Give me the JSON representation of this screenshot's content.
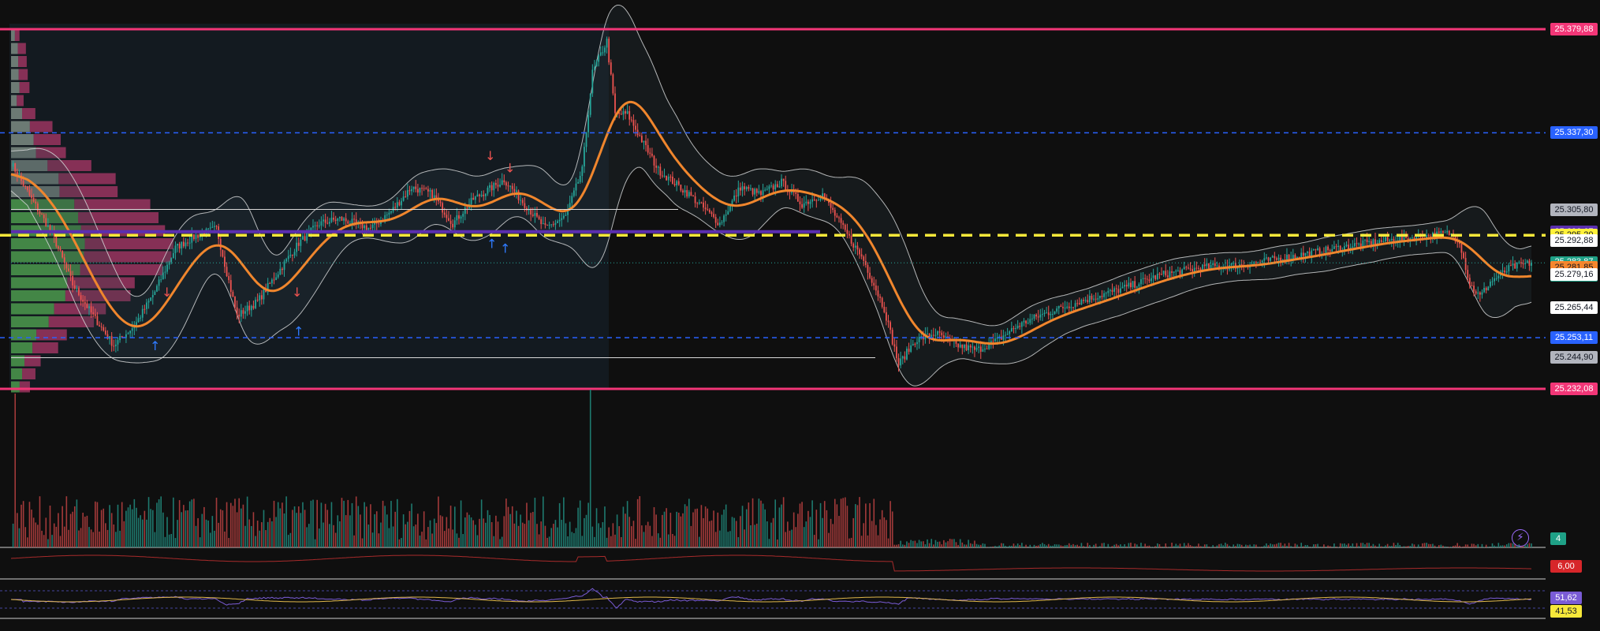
{
  "chart_data": {
    "type": "candlestick",
    "title": "",
    "price_axis": {
      "min": 25232.08,
      "max": 25379.88,
      "labels": [
        {
          "value": "25.379,88",
          "bg": "#f23677",
          "fg": "#ffffff"
        },
        {
          "value": "25.337,30",
          "bg": "#2962ff",
          "fg": "#ffffff"
        },
        {
          "value": "25.305,80",
          "bg": "#b2b5be",
          "fg": "#131722"
        },
        {
          "value": "25.296,67",
          "bg": "#5b2fb0",
          "fg": "#ffffff"
        },
        {
          "value": "25.295,20",
          "bg": "#fff23a",
          "fg": "#131722"
        },
        {
          "value": "25.292,88",
          "bg": "#ffffff",
          "fg": "#131722"
        },
        {
          "value": "25.283,87",
          "sub": "01:50",
          "bg": "#1fa187",
          "fg": "#ffffff"
        },
        {
          "value": "25.281,85",
          "bg": "#f5862d",
          "fg": "#131722"
        },
        {
          "value": "25.279,16",
          "bg": "#ffffff",
          "fg": "#131722"
        },
        {
          "value": "25.265,44",
          "bg": "#ffffff",
          "fg": "#131722"
        },
        {
          "value": "25.253,11",
          "bg": "#2962ff",
          "fg": "#ffffff"
        },
        {
          "value": "25.244,90",
          "bg": "#b2b5be",
          "fg": "#131722"
        },
        {
          "value": "25.232,08",
          "bg": "#f23677",
          "fg": "#ffffff"
        }
      ]
    },
    "horizontal_levels": [
      {
        "price": 25379.88,
        "style": "solid",
        "color": "#f23677"
      },
      {
        "price": 25337.3,
        "style": "dashed",
        "color": "#2962ff"
      },
      {
        "price": 25295.2,
        "style": "dashed",
        "color": "#f7e83a"
      },
      {
        "price": 25296.67,
        "style": "solid",
        "color": "#5b2fb0"
      },
      {
        "price": 25253.11,
        "style": "dashed",
        "color": "#2962ff"
      },
      {
        "price": 25232.08,
        "style": "solid",
        "color": "#f23677"
      }
    ],
    "close_path": [
      [
        0,
        25325
      ],
      [
        10,
        25310
      ],
      [
        20,
        25296
      ],
      [
        30,
        25275
      ],
      [
        40,
        25262
      ],
      [
        50,
        25250
      ],
      [
        60,
        25258
      ],
      [
        70,
        25272
      ],
      [
        80,
        25290
      ],
      [
        90,
        25295
      ],
      [
        100,
        25298
      ],
      [
        105,
        25280
      ],
      [
        110,
        25262
      ],
      [
        120,
        25268
      ],
      [
        130,
        25280
      ],
      [
        140,
        25292
      ],
      [
        150,
        25300
      ],
      [
        160,
        25302
      ],
      [
        175,
        25298
      ],
      [
        185,
        25305
      ],
      [
        195,
        25315
      ],
      [
        205,
        25312
      ],
      [
        215,
        25300
      ],
      [
        225,
        25310
      ],
      [
        240,
        25318
      ],
      [
        250,
        25308
      ],
      [
        260,
        25298
      ],
      [
        270,
        25303
      ],
      [
        278,
        25322
      ],
      [
        283,
        25362
      ],
      [
        290,
        25375
      ],
      [
        294,
        25345
      ],
      [
        300,
        25345
      ],
      [
        315,
        25322
      ],
      [
        330,
        25312
      ],
      [
        345,
        25300
      ],
      [
        355,
        25315
      ],
      [
        365,
        25312
      ],
      [
        375,
        25317
      ],
      [
        385,
        25308
      ],
      [
        395,
        25312
      ],
      [
        405,
        25298
      ],
      [
        415,
        25285
      ],
      [
        425,
        25265
      ],
      [
        432,
        25242
      ],
      [
        440,
        25252
      ],
      [
        450,
        25255
      ],
      [
        460,
        25250
      ],
      [
        470,
        25248
      ],
      [
        480,
        25252
      ],
      [
        490,
        25258
      ],
      [
        500,
        25262
      ],
      [
        510,
        25265
      ],
      [
        520,
        25268
      ],
      [
        540,
        25273
      ],
      [
        560,
        25279
      ],
      [
        580,
        25282
      ],
      [
        600,
        25283
      ],
      [
        620,
        25286
      ],
      [
        640,
        25289
      ],
      [
        660,
        25292
      ],
      [
        680,
        25294
      ],
      [
        700,
        25296
      ],
      [
        705,
        25293
      ],
      [
        710,
        25275
      ],
      [
        715,
        25270
      ],
      [
        720,
        25276
      ],
      [
        730,
        25282
      ],
      [
        740,
        25283.87
      ]
    ],
    "volume_axis_label": {
      "value": "4",
      "bg": "#1fa187",
      "fg": "#ffffff"
    },
    "oscillator_1_label": {
      "value": "6,00",
      "bg": "#d7262a",
      "fg": "#ffffff"
    },
    "oscillator_2_labels": [
      {
        "value": "51,62",
        "bg": "#7a5cd6",
        "fg": "#ffffff"
      },
      {
        "value": "41,53",
        "bg": "#f7e83a",
        "fg": "#131722"
      }
    ]
  },
  "ui": {
    "lightning_icon": "⚡"
  }
}
